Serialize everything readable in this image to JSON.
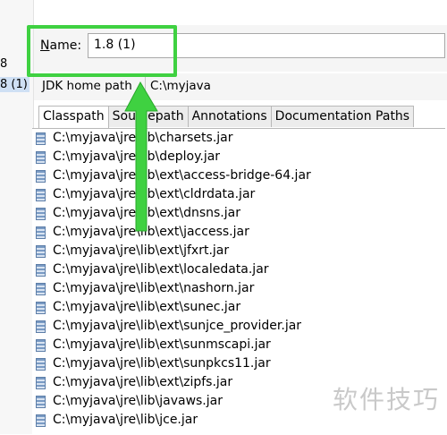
{
  "sdk_list": {
    "items": [
      {
        "label": "8"
      },
      {
        "label": "8 (1)"
      }
    ]
  },
  "name_field": {
    "label": "Name:",
    "value": "1.8 (1)"
  },
  "jdk_home": {
    "label": "JDK home path",
    "value": "C:\\myjava"
  },
  "tabs": [
    {
      "label": "Classpath"
    },
    {
      "label": "Sourcepath"
    },
    {
      "label": "Annotations"
    },
    {
      "label": "Documentation Paths"
    }
  ],
  "classpath": [
    {
      "path": "C:\\myjava\\jre\\lib\\charsets.jar"
    },
    {
      "path": "C:\\myjava\\jre\\lib\\deploy.jar"
    },
    {
      "path": "C:\\myjava\\jre\\lib\\ext\\access-bridge-64.jar"
    },
    {
      "path": "C:\\myjava\\jre\\lib\\ext\\cldrdata.jar"
    },
    {
      "path": "C:\\myjava\\jre\\lib\\ext\\dnsns.jar"
    },
    {
      "path": "C:\\myjava\\jre\\lib\\ext\\jaccess.jar"
    },
    {
      "path": "C:\\myjava\\jre\\lib\\ext\\jfxrt.jar"
    },
    {
      "path": "C:\\myjava\\jre\\lib\\ext\\localedata.jar"
    },
    {
      "path": "C:\\myjava\\jre\\lib\\ext\\nashorn.jar"
    },
    {
      "path": "C:\\myjava\\jre\\lib\\ext\\sunec.jar"
    },
    {
      "path": "C:\\myjava\\jre\\lib\\ext\\sunjce_provider.jar"
    },
    {
      "path": "C:\\myjava\\jre\\lib\\ext\\sunmscapi.jar"
    },
    {
      "path": "C:\\myjava\\jre\\lib\\ext\\sunpkcs11.jar"
    },
    {
      "path": "C:\\myjava\\jre\\lib\\ext\\zipfs.jar"
    },
    {
      "path": "C:\\myjava\\jre\\lib\\javaws.jar"
    },
    {
      "path": "C:\\myjava\\jre\\lib\\jce.jar"
    }
  ],
  "watermark": "软件技巧",
  "colors": {
    "highlight": "#3fd141",
    "selection": "#cfe0f4"
  }
}
